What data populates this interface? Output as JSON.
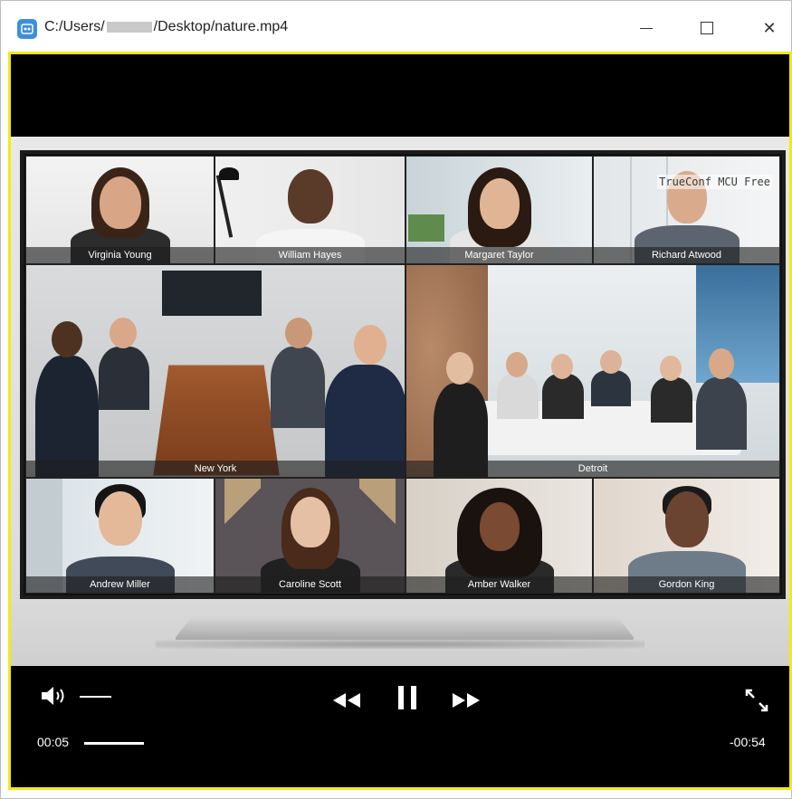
{
  "window": {
    "title_prefix": "C:/Users/",
    "title_suffix": "/Desktop/nature.mp4",
    "app_icon": "video-player-icon",
    "buttons": {
      "minimize": "minimize-icon",
      "maximize": "maximize-icon",
      "close": "close-icon"
    },
    "close_glyph": "✕"
  },
  "video": {
    "watermark": "TrueConf MCU Free",
    "participants": [
      {
        "name": "Virginia Young"
      },
      {
        "name": "William Hayes"
      },
      {
        "name": "Margaret Taylor"
      },
      {
        "name": "Richard Atwood"
      },
      {
        "name": "New York"
      },
      {
        "name": "Detroit"
      },
      {
        "name": "Andrew Miller"
      },
      {
        "name": "Caroline Scott"
      },
      {
        "name": "Amber Walker"
      },
      {
        "name": "Gordon King"
      }
    ]
  },
  "controls": {
    "volume_icon": "volume-icon",
    "rewind_icon": "rewind-icon",
    "pause_icon": "pause-icon",
    "forward_icon": "fast-forward-icon",
    "fullscreen_icon": "fullscreen-icon",
    "elapsed": "00:05",
    "remaining": "-00:54"
  },
  "colors": {
    "frame_border": "#f3ea13",
    "player_background": "#000000"
  }
}
